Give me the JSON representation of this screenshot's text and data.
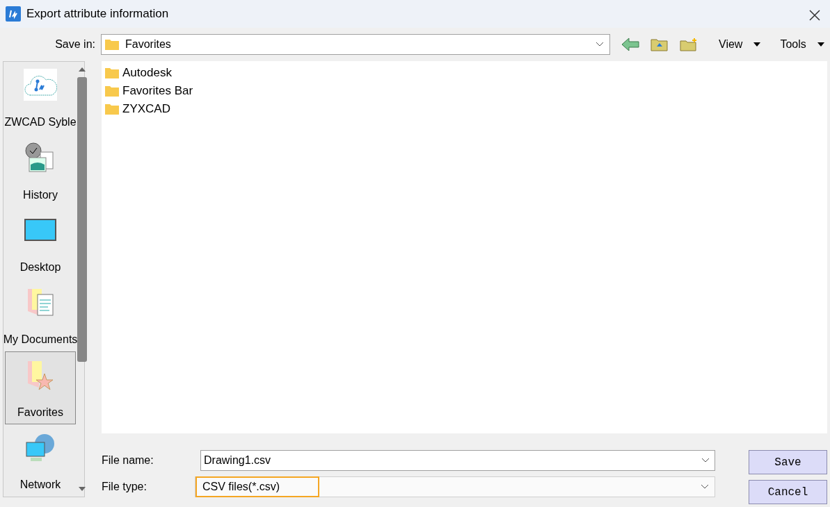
{
  "window": {
    "title": "Export attribute information"
  },
  "toolbar": {
    "save_in_label": "Save in:",
    "save_in_value": "Favorites",
    "view_menu": "View",
    "tools_menu": "Tools"
  },
  "places": [
    {
      "label": "ZWCAD Syble",
      "kind": "cloud",
      "selected": false
    },
    {
      "label": "History",
      "kind": "history",
      "selected": false
    },
    {
      "label": "Desktop",
      "kind": "desktop",
      "selected": false
    },
    {
      "label": "My Documents",
      "kind": "documents",
      "selected": false
    },
    {
      "label": "Favorites",
      "kind": "favorites",
      "selected": true
    },
    {
      "label": "Network",
      "kind": "network",
      "selected": false
    }
  ],
  "files": [
    {
      "name": "Autodesk"
    },
    {
      "name": "Favorites Bar"
    },
    {
      "name": "ZYXCAD"
    }
  ],
  "file_name": {
    "label": "File name:",
    "value": "Drawing1.csv"
  },
  "file_type": {
    "label": "File type:",
    "value": "CSV files(*.csv)",
    "highlighted": true
  },
  "buttons": [
    "Save",
    "Cancel"
  ]
}
